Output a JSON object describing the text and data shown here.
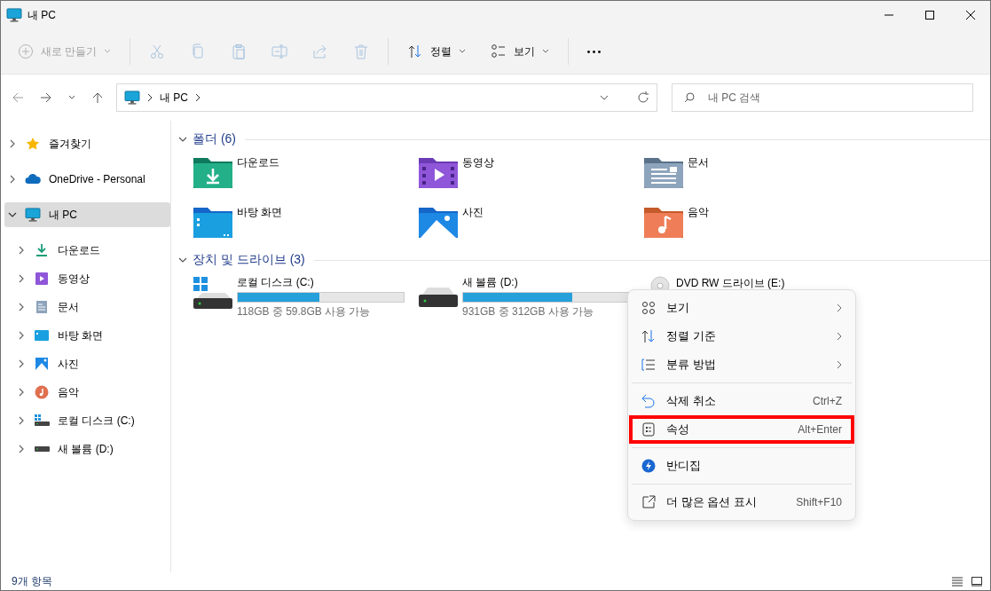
{
  "window": {
    "title": "내 PC"
  },
  "toolbar": [
    {
      "kind": "new",
      "label": "새로 만들기",
      "disabled": true
    },
    {
      "kind": "cut",
      "disabled": true
    },
    {
      "kind": "copy",
      "disabled": true
    },
    {
      "kind": "paste",
      "disabled": true
    },
    {
      "kind": "rename",
      "disabled": true
    },
    {
      "kind": "share",
      "disabled": true
    },
    {
      "kind": "delete",
      "disabled": true
    },
    {
      "kind": "sort",
      "label": "정렬",
      "disabled": false
    },
    {
      "kind": "view",
      "label": "보기",
      "disabled": false
    },
    {
      "kind": "more",
      "disabled": false
    }
  ],
  "address": {
    "path": [
      "내 PC"
    ]
  },
  "search": {
    "placeholder": "내 PC 검색"
  },
  "sidebar": {
    "items": [
      {
        "kind": "star",
        "label": "즐겨찾기",
        "expanded": false,
        "selected": false
      },
      {
        "kind": "cloud",
        "label": "OneDrive - Personal",
        "expanded": false,
        "selected": false
      },
      {
        "kind": "pc",
        "label": "내 PC",
        "expanded": true,
        "selected": true,
        "children": [
          {
            "kind": "downloads",
            "label": "다운로드",
            "expanded": false,
            "selected": false
          },
          {
            "kind": "videos",
            "label": "동영상",
            "expanded": false,
            "selected": false
          },
          {
            "kind": "documents",
            "label": "문서",
            "expanded": false,
            "selected": false
          },
          {
            "kind": "desktop",
            "label": "바탕 화면",
            "expanded": false,
            "selected": false
          },
          {
            "kind": "pictures",
            "label": "사진",
            "expanded": false,
            "selected": false
          },
          {
            "kind": "music",
            "label": "음악",
            "expanded": false,
            "selected": false
          },
          {
            "kind": "windows-drive",
            "label": "로컬 디스크 (C:)",
            "expanded": false,
            "selected": false
          },
          {
            "kind": "drive",
            "label": "새 볼륨 (D:)",
            "expanded": false,
            "selected": false
          }
        ]
      }
    ]
  },
  "sections": [
    {
      "title": "폴더 (6)",
      "expanded": true,
      "items": [
        {
          "kind": "downloads",
          "name": "다운로드"
        },
        {
          "kind": "videos",
          "name": "동영상"
        },
        {
          "kind": "documents",
          "name": "문서"
        },
        {
          "kind": "desktop",
          "name": "바탕 화면"
        },
        {
          "kind": "pictures",
          "name": "사진"
        },
        {
          "kind": "music",
          "name": "음악"
        }
      ]
    },
    {
      "title": "장치 및 드라이브 (3)",
      "expanded": true,
      "items": [
        {
          "kind": "windows-drive",
          "name": "로컬 디스크 (C:)",
          "level": 0.49,
          "detail": "118GB 중 59.8GB 사용 가능"
        },
        {
          "kind": "drive",
          "name": "새 볼륨 (D:)",
          "level": 0.66,
          "detail": "931GB 중 312GB 사용 가능"
        },
        {
          "kind": "dvd",
          "name": "DVD RW 드라이브 (E:)"
        }
      ]
    }
  ],
  "context_menu": [
    {
      "kind": "view",
      "label": "보기",
      "submenu": true,
      "highlighted": false
    },
    {
      "kind": "sort",
      "label": "정렬 기준",
      "submenu": true,
      "highlighted": false
    },
    {
      "kind": "group",
      "label": "분류 방법",
      "submenu": true,
      "highlighted": false
    },
    {
      "kind": "separator"
    },
    {
      "kind": "undo",
      "label": "삭제 취소",
      "shortcut": "Ctrl+Z",
      "submenu": false,
      "highlighted": false
    },
    {
      "kind": "properties",
      "label": "속성",
      "shortcut": "Alt+Enter",
      "submenu": false,
      "highlighted": true
    },
    {
      "kind": "separator"
    },
    {
      "kind": "bandizip",
      "label": "반디집",
      "submenu": false,
      "highlighted": false
    },
    {
      "kind": "separator"
    },
    {
      "kind": "more-options",
      "label": "더 많은 옵션 표시",
      "shortcut": "Shift+F10",
      "submenu": false,
      "highlighted": false
    }
  ],
  "status_bar": {
    "text": "9개 항목"
  }
}
